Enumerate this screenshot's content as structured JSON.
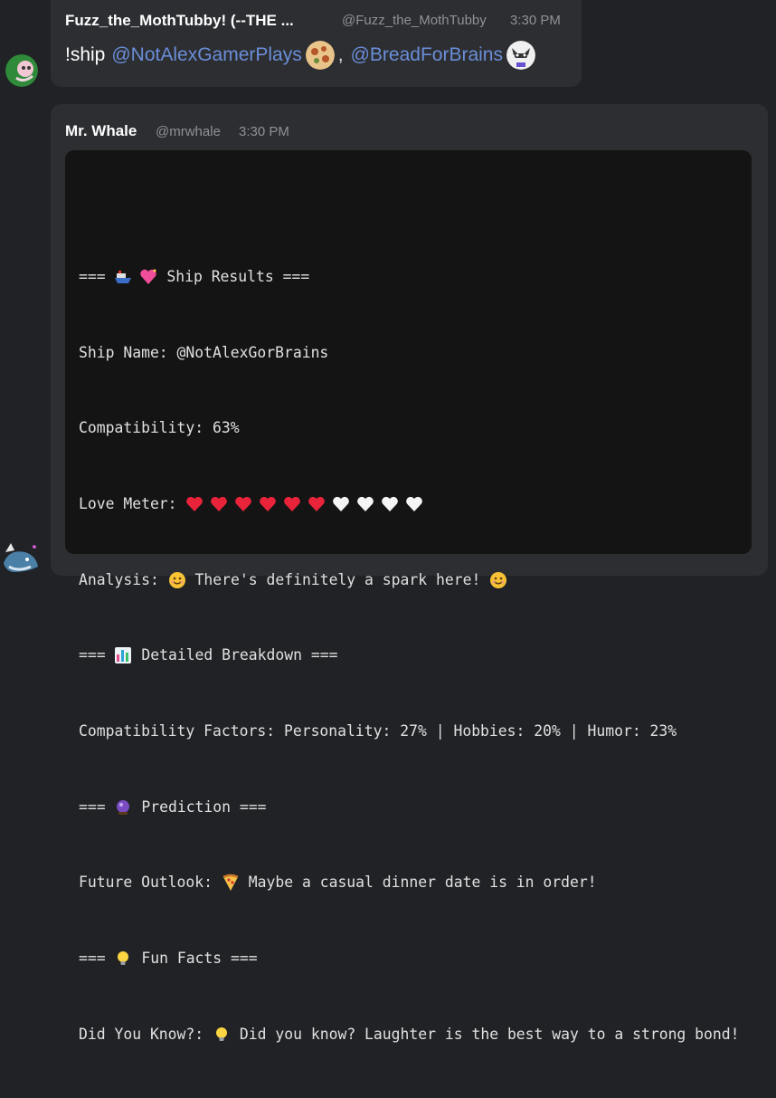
{
  "message1": {
    "author": "Fuzz_the_MothTubby! (--THE ...",
    "handle": "@Fuzz_the_MothTubby",
    "time": "3:30 PM",
    "command": "!ship",
    "mention1": "@NotAlexGamerPlays",
    "separator": ",",
    "mention2": "@BreadForBrains"
  },
  "message2": {
    "author": "Mr. Whale",
    "handle": "@mrwhale",
    "time": "3:30 PM",
    "lines": {
      "l1a": "=== ",
      "l1b": " Ship Results ===",
      "l2": "Ship Name: @NotAlexGorBrains",
      "l3": "Compatibility: 63%",
      "l4": "Love Meter: ",
      "l5a": "Analysis: ",
      "l5b": " There's definitely a spark here! ",
      "l6a": "=== ",
      "l6b": " Detailed Breakdown ===",
      "l7": "Compatibility Factors: Personality: 27% | Hobbies: 20% | Humor: 23%",
      "l8a": "=== ",
      "l8b": " Prediction ===",
      "l9a": "Future Outlook: ",
      "l9b": " Maybe a casual dinner date is in order!",
      "l10a": "=== ",
      "l10b": " Fun Facts ===",
      "l11a": "Did You Know?: ",
      "l11b": " Did you know? Laughter is the best way to a strong bond!"
    },
    "love_meter": {
      "filled": 6,
      "total": 10
    }
  },
  "colors": {
    "background": "#202225",
    "message_bg": "#2c2e31",
    "code_bg": "#141414",
    "mention": "#6b8ed9",
    "heart_red": "#e8233a",
    "heart_white": "#f5f5f5"
  },
  "icons": [
    "ship-icon",
    "sparkling-heart-icon",
    "smile-icon",
    "bar-chart-icon",
    "crystal-ball-icon",
    "pizza-icon",
    "lightbulb-icon",
    "red-heart-icon",
    "white-heart-icon"
  ]
}
